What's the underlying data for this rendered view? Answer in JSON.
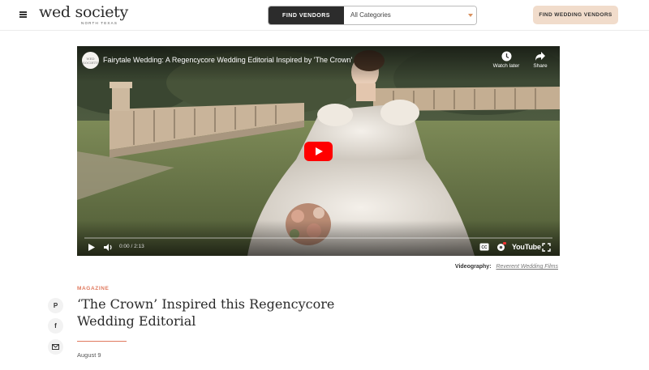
{
  "header": {
    "menu_icon": "hamburger-menu-icon",
    "logo": {
      "main": "wed society",
      "sub": "NORTH TEXAS"
    },
    "vendor_search": {
      "button_label": "FIND VENDORS",
      "category_value": "All Categories",
      "caret_icon": "chevron-down-icon",
      "caret_color": "#d9915f"
    },
    "cta_label": "FIND WEDDING VENDORS",
    "cta_color": "#f1dccb"
  },
  "video": {
    "channel_avatar_text": "WED SOCIETY",
    "title": "Fairytale Wedding: A Regencycore Wedding Editorial Inspired by 'The Crown'",
    "watch_later_label": "Watch later",
    "share_label": "Share",
    "time": "0:00 / 2:13",
    "progress": 0,
    "platform_logo": "YouTube",
    "icons": [
      "play-icon",
      "volume-icon",
      "captions-icon",
      "settings-icon",
      "fullscreen-icon",
      "clock-icon",
      "share-arrow-icon"
    ],
    "play_button_color": "#ff0000"
  },
  "credit": {
    "label": "Videography:",
    "link_text": "Reverent Wedding Films"
  },
  "share_rail": [
    "pinterest-icon",
    "facebook-icon",
    "email-icon"
  ],
  "article": {
    "category": "MAGAZINE",
    "title": "‘The Crown’ Inspired this Regencycore Wedding Editorial",
    "date": "August 9",
    "accent_color": "#e07a5f"
  }
}
